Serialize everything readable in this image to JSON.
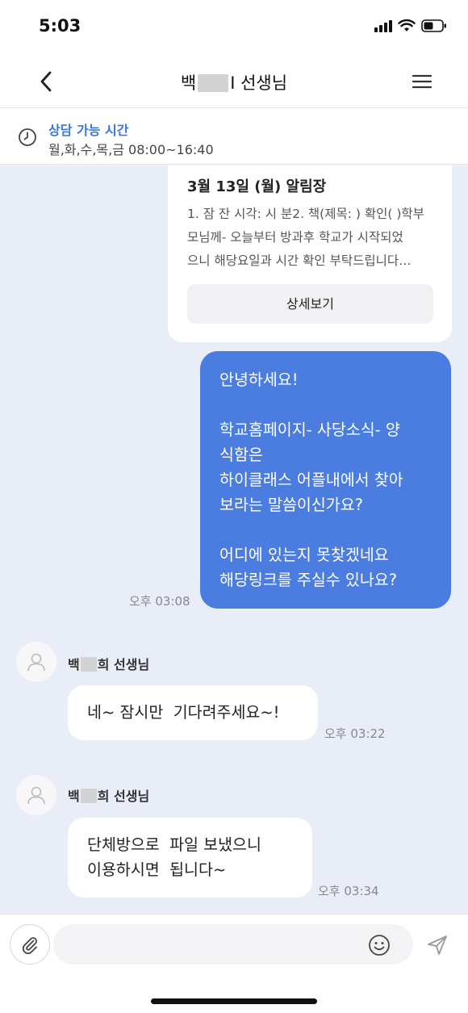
{
  "status_bar": {
    "time": "5:03"
  },
  "header": {
    "title_prefix": "백",
    "title_suffix": "I 선생님"
  },
  "consult": {
    "label": "상담 가능 시간",
    "hours": "월,화,수,목,금 08:00~16:40"
  },
  "notice": {
    "title": "3월 13일 (월) 알림장",
    "lines": [
      "1. 잠 잔 시각: 시 분2. 책(제목: ) 확인( )학부",
      "모님께- 오늘부터 방과후 학교가 시작되었",
      "으니 해당요일과 시간 확인 부탁드립니다…"
    ],
    "button_label": "상세보기"
  },
  "messages": {
    "mine": {
      "lines": [
        "안녕하세요!",
        "",
        "학교홈페이지- 사당소식- 양",
        "식함은",
        "하이클래스 어플내에서 찾아",
        "보라는 말씀이신가요?",
        "",
        "어디에 있는지 못찾겠네요",
        "해당링크를 주실수 있나요?"
      ],
      "time": "오후 03:08"
    },
    "reply1": {
      "sender_prefix": "백",
      "sender_suffix": "희 선생님",
      "text": "네~ 잠시만  기다려주세요~!",
      "time": "오후 03:22"
    },
    "reply2": {
      "sender_prefix": "백",
      "sender_suffix": "희 선생님",
      "text": "단체방으로  파일 보냈으니\n이용하시면  됩니다~",
      "time": "오후 03:34"
    }
  },
  "input": {
    "value": ""
  },
  "colors": {
    "accent": "#4a7ddf",
    "chat_bg": "#e8edf8",
    "consult_label": "#3a78dc"
  },
  "icons": [
    "chevron-left-icon",
    "menu-icon",
    "clock-icon",
    "user-icon",
    "paperclip-icon",
    "smile-icon",
    "send-icon"
  ]
}
